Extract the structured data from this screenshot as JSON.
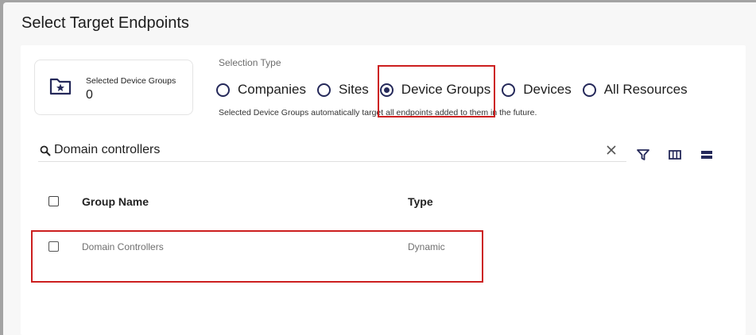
{
  "dialog": {
    "title": "Select Target Endpoints"
  },
  "summary": {
    "label": "Selected Device Groups",
    "count": "0",
    "icon": "folder-star-icon"
  },
  "selection": {
    "label": "Selection Type",
    "options": [
      {
        "label": "Companies",
        "selected": false
      },
      {
        "label": "Sites",
        "selected": false
      },
      {
        "label": "Device Groups",
        "selected": true
      },
      {
        "label": "Devices",
        "selected": false
      },
      {
        "label": "All Resources",
        "selected": false
      }
    ],
    "helper": "Selected Device Groups automatically target all endpoints added to them in the future."
  },
  "search": {
    "value": "Domain controllers",
    "icons": [
      "search-icon",
      "clear-icon"
    ]
  },
  "toolbar": {
    "icons": [
      "filter-icon",
      "columns-icon",
      "density-icon"
    ]
  },
  "table": {
    "columns": [
      "Group Name",
      "Type"
    ],
    "rows": [
      {
        "name": "Domain Controllers",
        "type": "Dynamic"
      }
    ]
  },
  "colors": {
    "accent": "#25295a",
    "highlight": "#cc1f1f"
  }
}
